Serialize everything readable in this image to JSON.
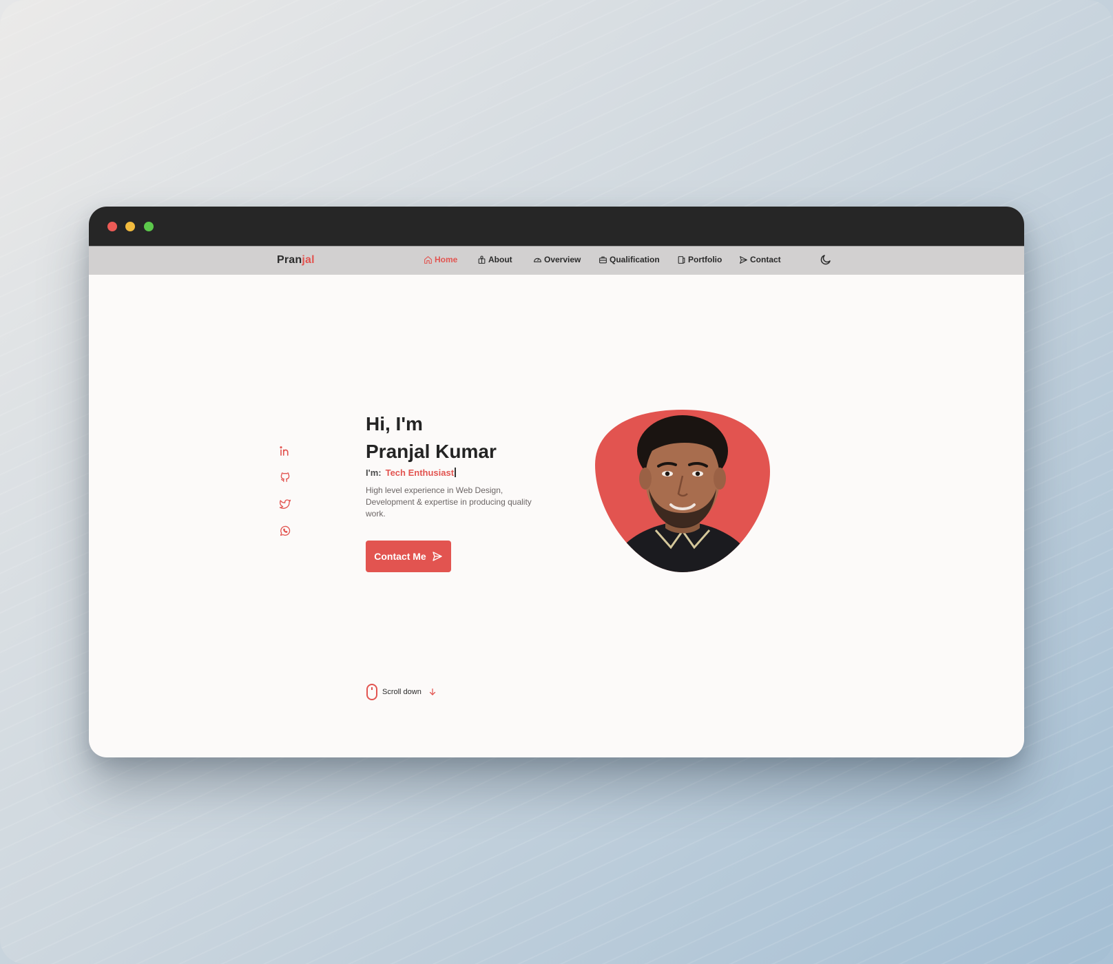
{
  "colors": {
    "accent": "#e25450",
    "navbar_bg": "#d2d0d0",
    "page_bg": "#fcfaf9",
    "titlebar_bg": "#262626"
  },
  "header": {
    "brand_prefix": "Pran",
    "brand_accent": "jal",
    "nav_items": [
      {
        "label": "Home",
        "icon": "home-icon",
        "active": true
      },
      {
        "label": "About",
        "icon": "user-icon",
        "active": false
      },
      {
        "label": "Overview",
        "icon": "gauge-icon",
        "active": false
      },
      {
        "label": "Qualification",
        "icon": "briefcase-icon",
        "active": false
      },
      {
        "label": "Portfolio",
        "icon": "portfolio-icon",
        "active": false
      },
      {
        "label": "Contact",
        "icon": "send-icon",
        "active": false
      }
    ],
    "theme_toggle_icon": "moon-icon"
  },
  "socials": [
    {
      "icon": "linkedin-icon"
    },
    {
      "icon": "github-icon"
    },
    {
      "icon": "twitter-icon"
    },
    {
      "icon": "whatsapp-icon"
    }
  ],
  "hero": {
    "greeting": "Hi, I'm",
    "name": "Pranjal Kumar",
    "role_prefix": "I'm:",
    "role_value": "Tech Enthusiast",
    "description": "High level experience in Web Design, Development & expertise in producing quality work.",
    "cta_label": "Contact Me",
    "cta_icon": "send-icon"
  },
  "scroll": {
    "label": "Scroll down",
    "icon": "mouse-icon",
    "arrow_icon": "arrow-down-icon"
  }
}
